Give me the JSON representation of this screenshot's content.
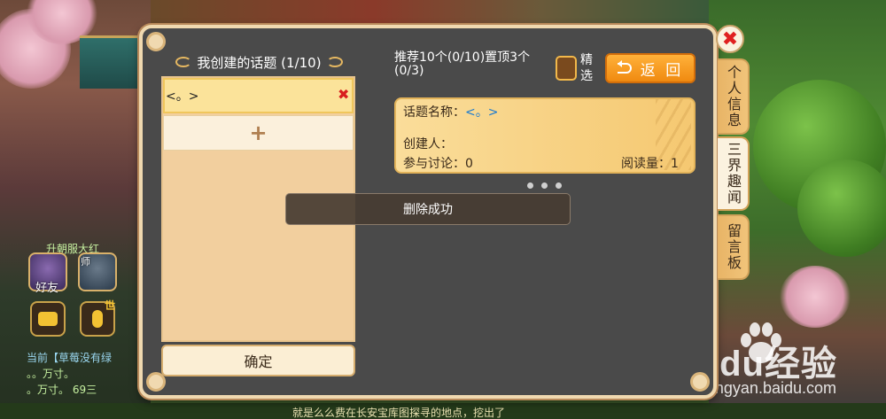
{
  "background": {
    "bottom_text": "就是么么费在长安宝库图探寻的地点，挖出了",
    "hud": {
      "top_label": "升朝服大红",
      "friend_label": "好友",
      "master_label": "师",
      "world_label": "世",
      "chat_lines": [
        "当前【草莓没有绿",
        "。。万寸。",
        "。万寸。 69三"
      ]
    },
    "watermark": {
      "main": "Bai●du经验",
      "sub": "jingyan.baidu.com"
    }
  },
  "dialog": {
    "close_icon": "✖",
    "left_panel": {
      "title": "我创建的话题 (1/10)",
      "topics": [
        {
          "name": "<。>",
          "delete_icon": "✖"
        }
      ],
      "add_icon": "+",
      "confirm_label": "确定"
    },
    "right_panel": {
      "recommend_text": "推荐10个(0/10)置顶3个(0/3)",
      "featured_label": "精选",
      "back_label": "返 回",
      "card": {
        "topic_label": "话题名称：",
        "topic_value": "<。>",
        "creator_label": "创建人：",
        "discussion_label": "参与讨论：",
        "discussion_value": "0",
        "reads_label": "阅读量：",
        "reads_value": "1"
      }
    },
    "side_tabs": [
      {
        "label": "个人信息"
      },
      {
        "label": "三界趣闻"
      },
      {
        "label": "留言板"
      }
    ],
    "toast": "删除成功"
  }
}
